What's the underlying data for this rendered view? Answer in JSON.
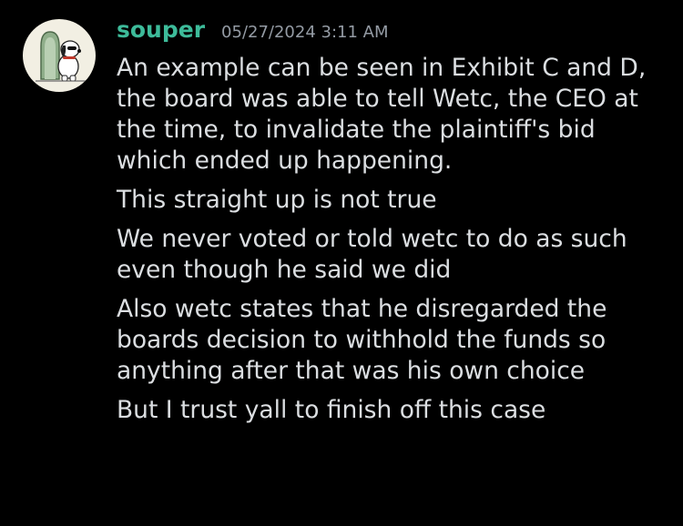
{
  "colors": {
    "background": "#000000",
    "username": "#3dbb9a",
    "timestamp": "#949ba4",
    "text": "#dbdee1"
  },
  "message": {
    "avatar_icon": "snoopy-avatar-icon",
    "username": "souper",
    "timestamp": "05/27/2024 3:11 AM",
    "lines": [
      "An example can be seen in Exhibit C and D, the board was able to tell Wetc, the CEO at the time, to invalidate the plaintiff's bid which ended up happening.",
      "This straight up is not true",
      "We never voted or told wetc to do as such even though he said we did",
      "Also wetc states that he disregarded the boards decision to withhold the funds so anything after that was his own choice",
      "But I trust yall to finish off this case"
    ]
  }
}
